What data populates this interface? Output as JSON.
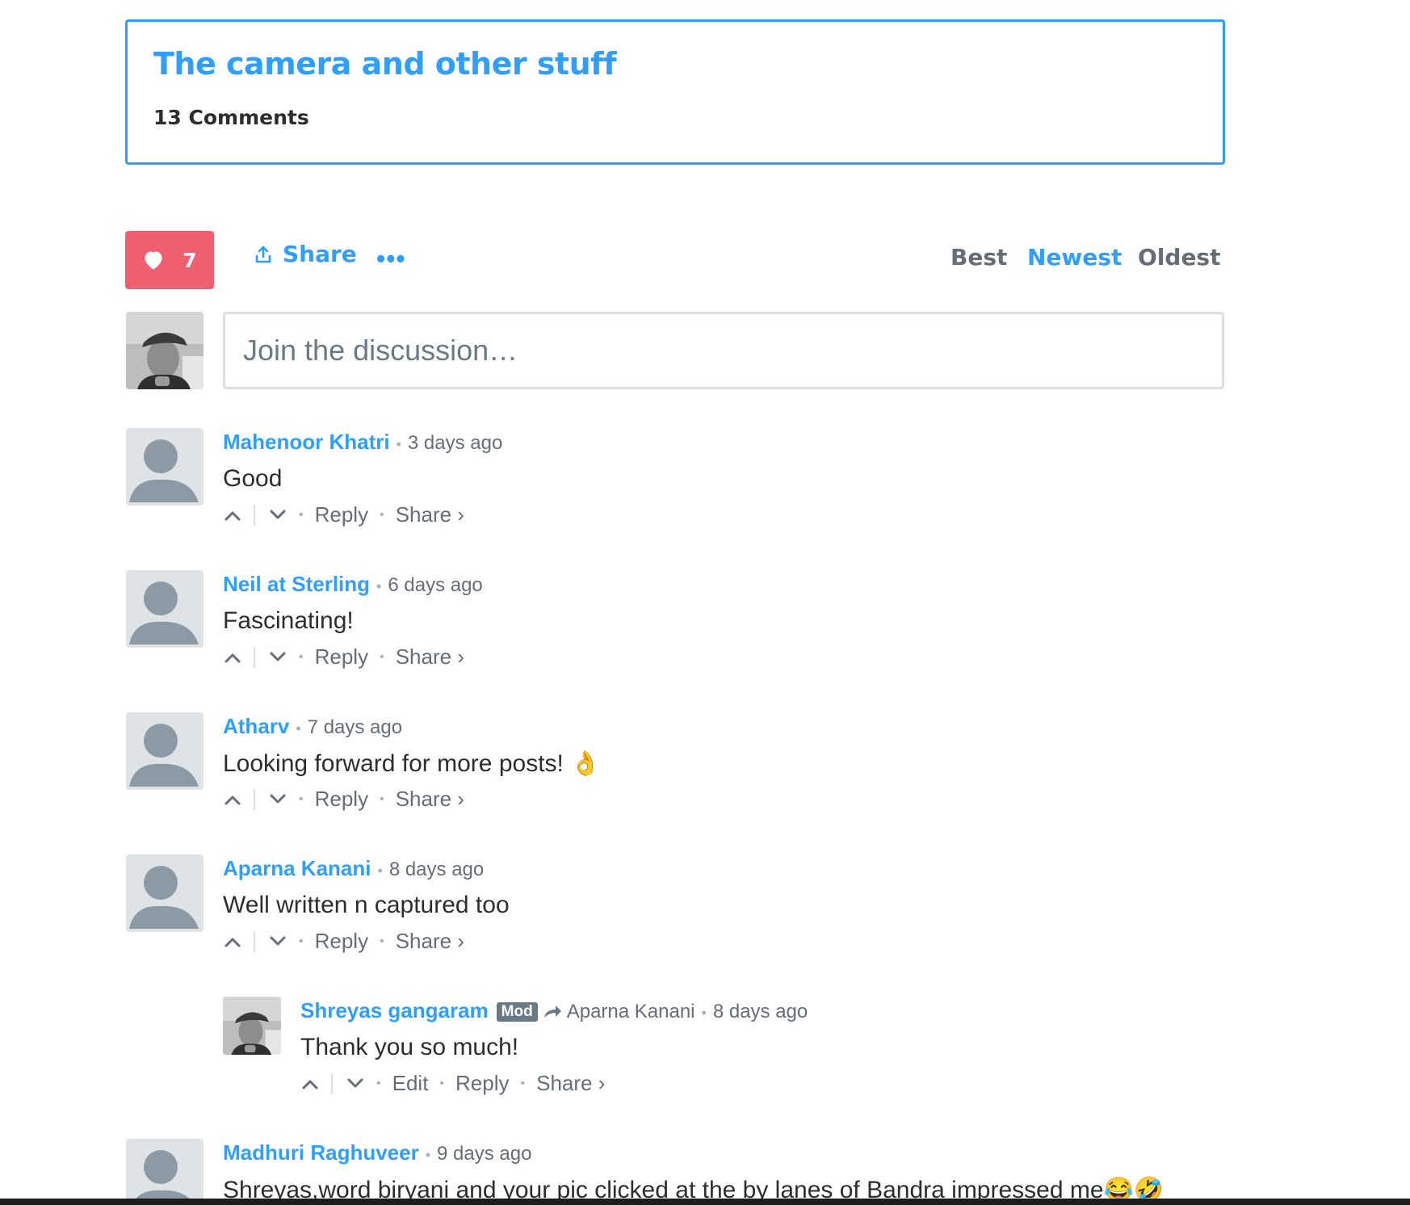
{
  "post": {
    "title": "The camera and other stuff",
    "comment_count": "13 Comments"
  },
  "toolbar": {
    "like_count": "7",
    "share_label": "Share",
    "more_label": "•••",
    "sort_tabs": [
      "Best",
      "Newest",
      "Oldest"
    ],
    "active_sort": "Newest"
  },
  "compose": {
    "placeholder": "Join the discussion…"
  },
  "colors": {
    "accent": "#2e9fff",
    "like": "#f05f70",
    "muted": "#656c7a",
    "text": "#2a2e2e"
  },
  "comments": [
    {
      "author": "Mahenoor Khatri",
      "time": "3 days ago",
      "body": "Good",
      "actions": [
        "Reply",
        "Share ›"
      ]
    },
    {
      "author": "Neil at Sterling",
      "time": "6 days ago",
      "body": "Fascinating!",
      "actions": [
        "Reply",
        "Share ›"
      ]
    },
    {
      "author": "Atharv",
      "time": "7 days ago",
      "body": "Looking forward for more posts! 👌",
      "actions": [
        "Reply",
        "Share ›"
      ]
    },
    {
      "author": "Aparna Kanani",
      "time": "8 days ago",
      "body": "Well written n captured too",
      "actions": [
        "Reply",
        "Share ›"
      ]
    },
    {
      "author": "Shreyas gangaram",
      "badge": "Mod",
      "reply_to": "Aparna Kanani",
      "time": "8 days ago",
      "body": "Thank you so much!",
      "actions": [
        "Edit",
        "Reply",
        "Share ›"
      ]
    },
    {
      "author": "Madhuri Raghuveer",
      "time": "9 days ago",
      "body": "Shreyas,word biryani and your pic clicked at the by lanes of Bandra impressed me😂🤣"
    }
  ]
}
